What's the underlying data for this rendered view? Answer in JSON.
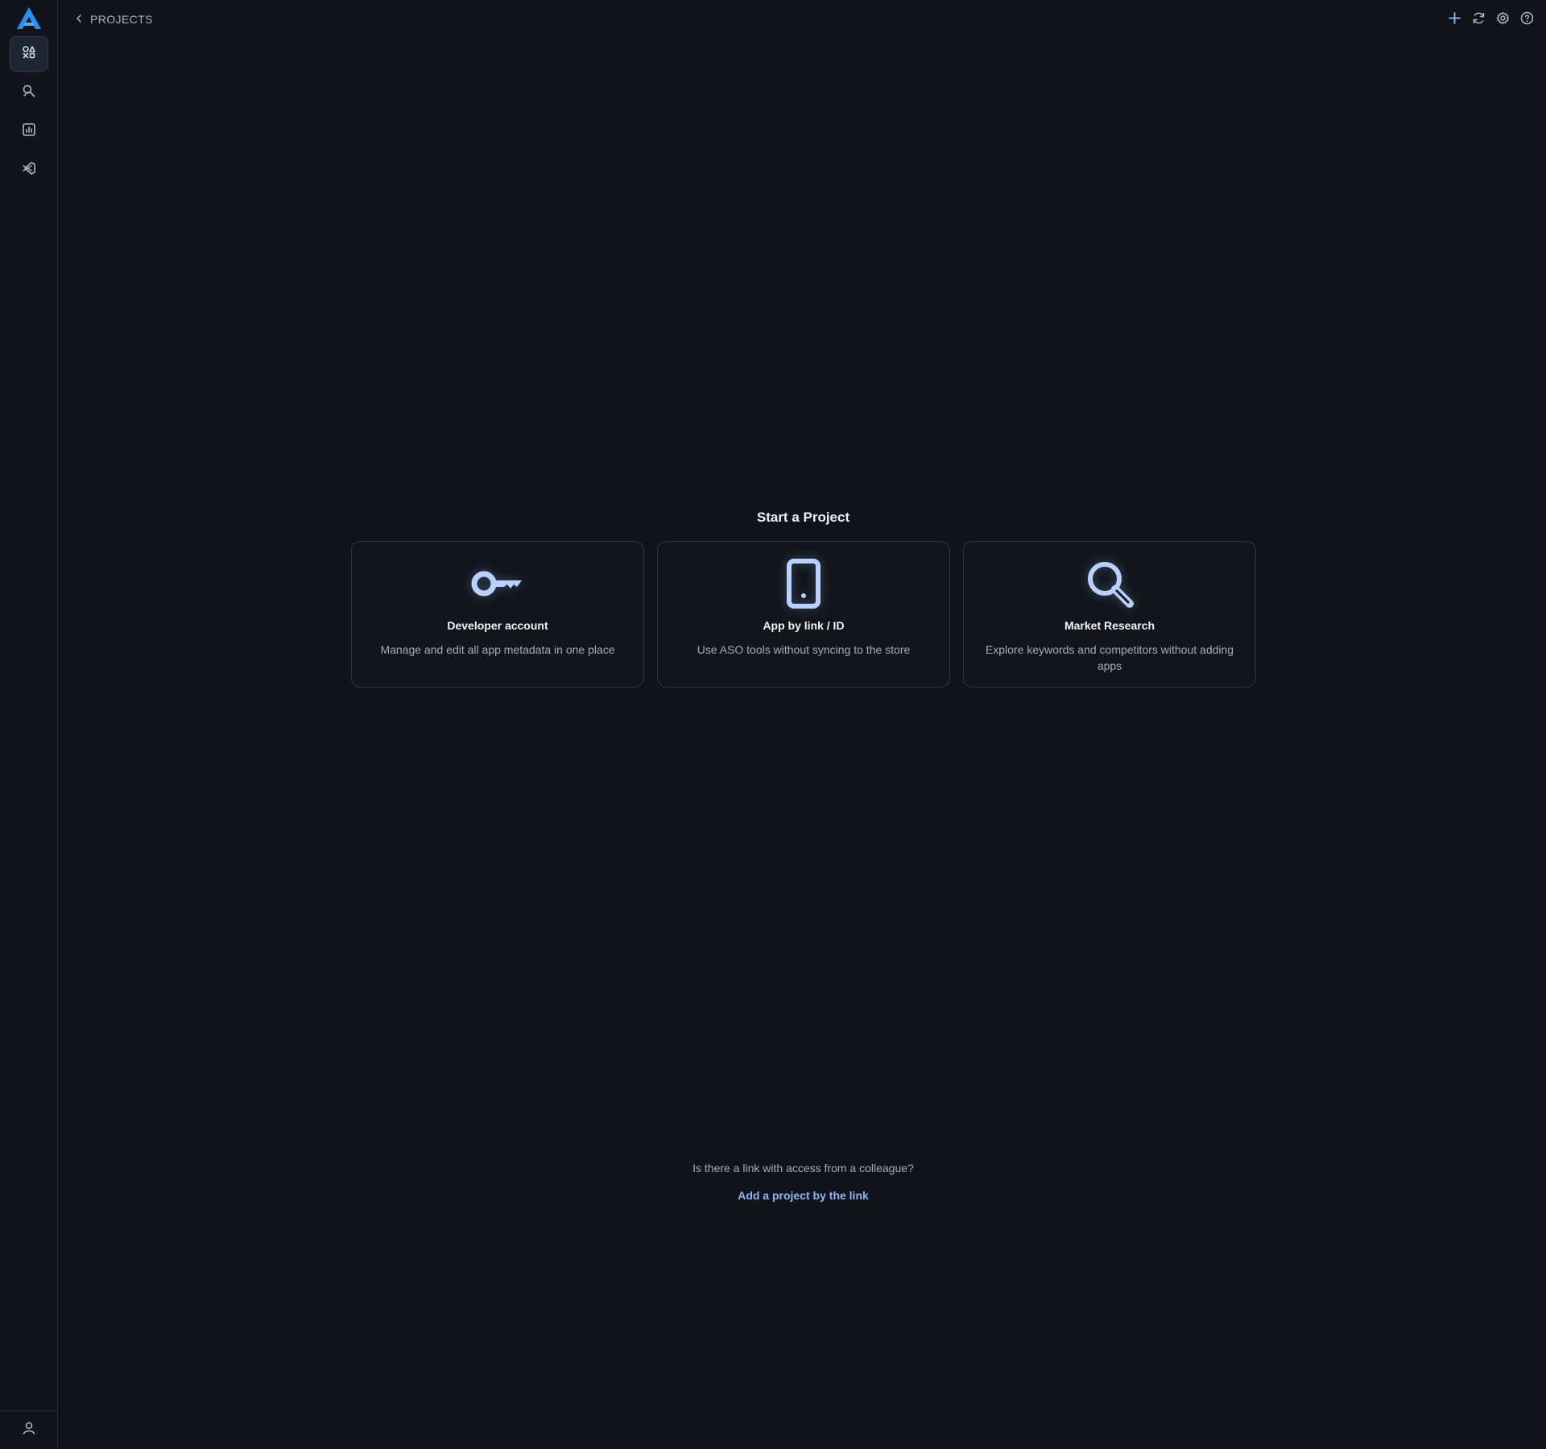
{
  "breadcrumb": {
    "label": "PROJECTS"
  },
  "sidebar": {
    "items": [
      {
        "name": "projects",
        "icon": "grid-projects-icon",
        "active": true
      },
      {
        "name": "keywords",
        "icon": "search-tool-icon",
        "active": false
      },
      {
        "name": "analytics",
        "icon": "chart-icon",
        "active": false
      },
      {
        "name": "integrations",
        "icon": "code-icon",
        "active": false
      }
    ],
    "user_icon": "user-icon"
  },
  "top_actions": [
    "plus-icon",
    "refresh-icon",
    "gear-icon",
    "help-icon"
  ],
  "main": {
    "title": "Start a Project",
    "cards": [
      {
        "icon": "key-icon",
        "title": "Developer account",
        "description": "Manage and edit all app metadata in one place"
      },
      {
        "icon": "phone-icon",
        "title": "App by link / ID",
        "description": "Use ASO tools without syncing to the store"
      },
      {
        "icon": "magnifier-icon",
        "title": "Market Research",
        "description": "Explore keywords and competitors without adding apps"
      }
    ]
  },
  "footer": {
    "question": "Is there a link with access from a colleague?",
    "link": "Add a project by the link"
  },
  "colors": {
    "background": "#11151b",
    "accent": "#8fb6f5",
    "icon_glow": "#b9d1ff",
    "logo": "#2f8cf0"
  }
}
